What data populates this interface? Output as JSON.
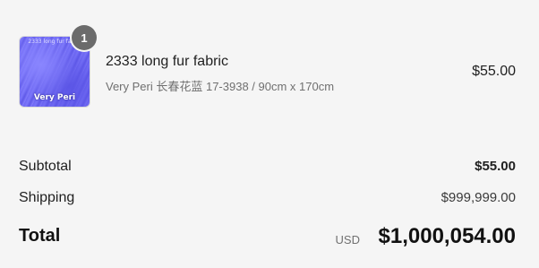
{
  "line_item": {
    "quantity": "1",
    "title": "2333 long fur fabric",
    "variant": "Very Peri 长春花蓝 17-3938 / 90cm x 170cm",
    "price": "$55.00",
    "thumbnail": {
      "top_text": "2333 long fur fabric",
      "caption": "Very Peri",
      "color": "#6c66f0"
    }
  },
  "summary": {
    "subtotal_label": "Subtotal",
    "subtotal_value": "$55.00",
    "shipping_label": "Shipping",
    "shipping_value": "$999,999.00",
    "total_label": "Total",
    "total_currency": "USD",
    "total_value": "$1,000,054.00"
  }
}
